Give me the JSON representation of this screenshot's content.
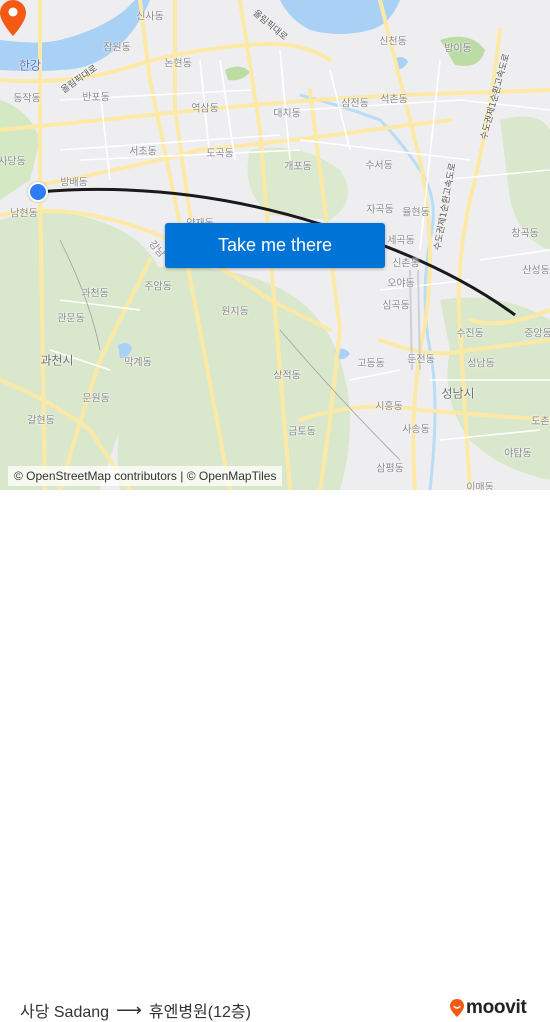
{
  "map": {
    "colors": {
      "land": "#eeeef0",
      "water": "#a8d1f5",
      "park": "#d5e8c4",
      "road_major": "#fde9a6",
      "road_minor": "#ffffff",
      "route_line": "#1a1a1a",
      "origin_marker": "#2f7cf6",
      "destination_marker": "#f45a14",
      "button": "#0073d6"
    },
    "labels": {
      "hangang": "한강",
      "sinsa": "신사동",
      "jamwon": "잠원동",
      "nonhyeon": "논현동",
      "banpo": "반포동",
      "dongjak": "동작동",
      "yeoksam": "역삼동",
      "daechi": "대치동",
      "samjeon": "삼전동",
      "seokchon": "석촌동",
      "sincheon": "신천동",
      "bangi": "방이동",
      "seocho": "서초동",
      "dogok": "도곡동",
      "sadang": "사당동",
      "bangbae": "방배동",
      "namhyeon": "남현동",
      "gaepo": "개포동",
      "suseo": "수서동",
      "jagok": "자곡동",
      "yulhyeon": "율현동",
      "segok": "세곡동",
      "sinchon2": "신촌동",
      "oya": "오야동",
      "simgok": "심곡동",
      "changgok": "창곡동",
      "sanseong": "산성동",
      "yangjae": "양재동",
      "gangnam": "강남",
      "gwacheon_dong": "과천동",
      "juam": "주암동",
      "wonji": "원지동",
      "gwanmun": "관문동",
      "gwacheon_si": "과천시",
      "makgye": "막계동",
      "munwon": "문원동",
      "galhyeon": "갈현동",
      "sangjeok": "상적동",
      "godeung": "고등동",
      "dunjeon": "둔전동",
      "sujin": "수진동",
      "jungang": "중앙동",
      "seongnam_dong": "성남동",
      "seongnam_si": "성남시",
      "siheung": "시흥동",
      "sasong": "사송동",
      "geumto": "금토동",
      "sampyeong": "삼평동",
      "yatap": "야탑동",
      "imae": "이매동",
      "dochon": "도촌동"
    },
    "roads": {
      "olympic_daero_west": "올림픽대로",
      "olympic_daero_east": "올림픽대로",
      "capital_ring_1": "수도권제1순환고속도로",
      "capital_ring_2": "수도권제1순환고속도로"
    },
    "attribution": "© OpenStreetMap contributors | © OpenMapTiles"
  },
  "cta": {
    "label": "Take me there"
  },
  "route": {
    "origin": "사당 Sadang",
    "arrow": "⟶",
    "destination": "휴엔병원(12층)"
  },
  "brand": {
    "name": "moovit",
    "color": "#f45a14"
  }
}
